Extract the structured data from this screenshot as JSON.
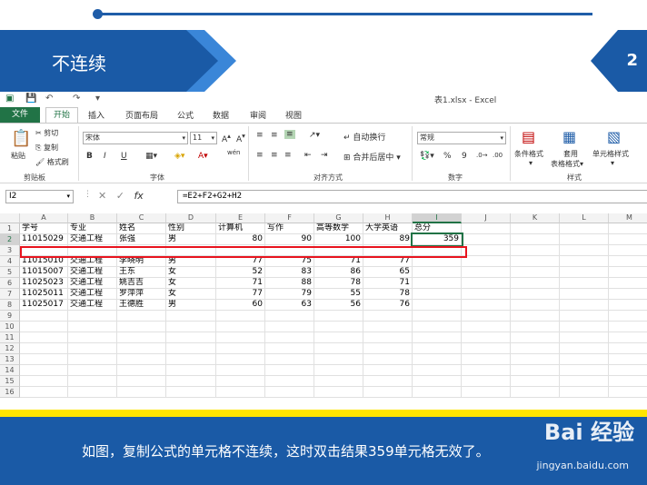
{
  "slide": {
    "title": "不连续",
    "page_number": "2",
    "caption": "如图，复制公式的单元格不连续，这时双击结果359单元格无效了。",
    "watermark": "Bai 经验",
    "watermark_url": "jingyan.baidu.com"
  },
  "excel": {
    "window_title": "表1.xlsx - Excel",
    "tabs": [
      "文件",
      "开始",
      "插入",
      "页面布局",
      "公式",
      "数据",
      "审阅",
      "视图"
    ],
    "ribbon": {
      "paste": "粘贴",
      "cut": "剪切",
      "copy": "复制",
      "format_painter": "格式刷",
      "clipboard_group": "剪贴板",
      "font_name": "宋体",
      "font_size": "11",
      "font_group": "字体",
      "bold": "B",
      "italic": "I",
      "underline": "U",
      "wrap_text": "自动换行",
      "merge_center": "合并后居中",
      "alignment_group": "对齐方式",
      "number_format": "常规",
      "percent": "%",
      "comma": "9",
      "number_group": "数字",
      "conditional_format": "条件格式",
      "table_format_1": "套用",
      "table_format_2": "表格格式",
      "cell_styles": "单元格样式",
      "styles_group": "样式",
      "wen_icon": "wén"
    },
    "name_box": "I2",
    "formula": "=E2+F2+G2+H2",
    "fx": "fx",
    "columns": [
      "A",
      "B",
      "C",
      "D",
      "E",
      "F",
      "G",
      "H",
      "I",
      "J",
      "K",
      "L",
      "M"
    ],
    "row_numbers": [
      "1",
      "2",
      "3",
      "4",
      "5",
      "6",
      "7",
      "8",
      "9",
      "10",
      "11",
      "12",
      "13",
      "14",
      "15",
      "16"
    ],
    "rows": [
      [
        "学号",
        "专业",
        "姓名",
        "性别",
        "计算机",
        "写作",
        "高等数学",
        "大学英语",
        "总分"
      ],
      [
        "11015029",
        "交通工程",
        "张强",
        "男",
        "80",
        "90",
        "100",
        "89",
        "359"
      ],
      [
        "",
        "",
        "",
        "",
        "",
        "",
        "",
        "",
        ""
      ],
      [
        "11015010",
        "交通工程",
        "李晓明",
        "男",
        "77",
        "75",
        "71",
        "77",
        ""
      ],
      [
        "11015007",
        "交通工程",
        "王东",
        "女",
        "52",
        "83",
        "86",
        "65",
        ""
      ],
      [
        "11025023",
        "交通工程",
        "姚吉吉",
        "女",
        "71",
        "88",
        "78",
        "71",
        ""
      ],
      [
        "11025011",
        "交通工程",
        "罗萍萍",
        "女",
        "77",
        "79",
        "55",
        "78",
        ""
      ],
      [
        "11025017",
        "交通工程",
        "王德胜",
        "男",
        "60",
        "63",
        "56",
        "76",
        ""
      ]
    ],
    "colors": {
      "excel_green": "#217346",
      "slide_blue": "#1a5aa6",
      "highlight_red": "#e8141e",
      "band_yellow": "#ffe500"
    }
  }
}
